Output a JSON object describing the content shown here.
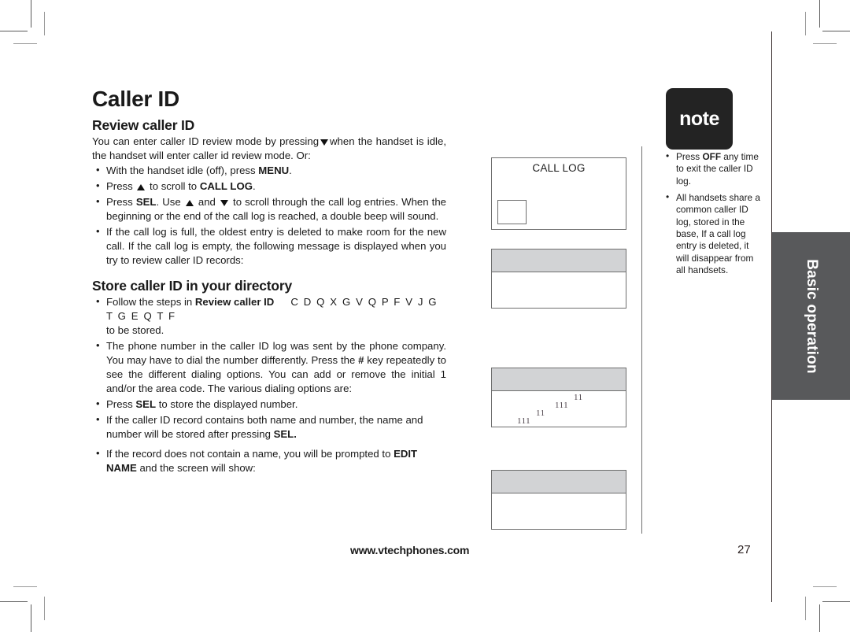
{
  "page": {
    "title": "Caller ID",
    "number": "27",
    "footer_url": "www.vtechphones.com",
    "side_tab_label": "Basic operation"
  },
  "sections": [
    {
      "heading": "Review caller ID",
      "intro_a": "You can enter caller ID review mode by pressing",
      "intro_b": "when the handset is idle, the handset will enter caller id review mode. Or:",
      "bullets": [
        {
          "id": "bullet-menu",
          "parts": [
            "With the handset  idle (off), press ",
            "MENU",
            "."
          ]
        },
        {
          "id": "bullet-scroll-calllog",
          "parts": [
            "Press ",
            "▲",
            " to scroll to ",
            "CALL LOG",
            "."
          ]
        },
        {
          "id": "bullet-sel-scroll",
          "parts": [
            "Press ",
            "SEL",
            ". Use ",
            "▲",
            " and ",
            "▼",
            " to scroll through the call log entries. When the beginning or the end of the call log is reached, a double beep will sound."
          ]
        },
        {
          "id": "bullet-log-full",
          "parts": [
            "If the call log is full, the oldest entry is deleted to make room for the new call. If the call log is empty, the following message is displayed when you try to review caller ID records:"
          ]
        }
      ]
    },
    {
      "heading": "Store caller ID in your directory",
      "bullets": [
        {
          "id": "bullet-follow-steps",
          "parts": [
            "Follow the steps in ",
            "Review caller ID",
            "C D Q X G   V Q   P F  V J G  T G E Q T F",
            "to be stored."
          ]
        },
        {
          "id": "bullet-phone-number",
          "parts": [
            "The phone number in the caller ID log was sent by the phone company. You may have to dial the number differently. Press the ",
            "#",
            " key repeatedly to see the different dialing options. You can add or remove the initial 1 and/or the area code. The various dialing options are:"
          ]
        },
        {
          "id": "bullet-press-sel-store",
          "parts": [
            "Press ",
            "SEL",
            " to store the displayed number."
          ]
        },
        {
          "id": "bullet-name-and-number",
          "parts": [
            "If the caller ID record contains both name and number, the name and number will be stored after pressing ",
            "SEL."
          ]
        },
        {
          "id": "bullet-edit-name",
          "parts": [
            "If the record does not contain a name, you will be prompted to ",
            "EDIT NAME",
            " and the screen will show:"
          ]
        }
      ]
    }
  ],
  "screens": [
    {
      "id": "screen-call-log",
      "title": "CALL LOG",
      "has_cursor_box": true
    },
    {
      "id": "screen-empty-1",
      "title": "",
      "has_cursor_box": false
    },
    {
      "id": "screen-digits",
      "title": "",
      "digits": [
        "11",
        "111",
        "11",
        "111"
      ]
    },
    {
      "id": "screen-empty-2",
      "title": "",
      "has_cursor_box": false
    }
  ],
  "note": {
    "badge_label": "note",
    "items": [
      {
        "id": "note-press-off",
        "parts": [
          "Press ",
          "OFF",
          " any time to exit the caller ID log."
        ]
      },
      {
        "id": "note-shared-log",
        "parts": [
          "All handsets share a common caller ID log, stored in the base, If a call log entry is deleted, it will disappear from all handsets."
        ]
      }
    ]
  },
  "colors": {
    "tab_grey": "#58595b",
    "screen_header_grey": "#d2d3d5",
    "note_badge_black": "#232323"
  }
}
